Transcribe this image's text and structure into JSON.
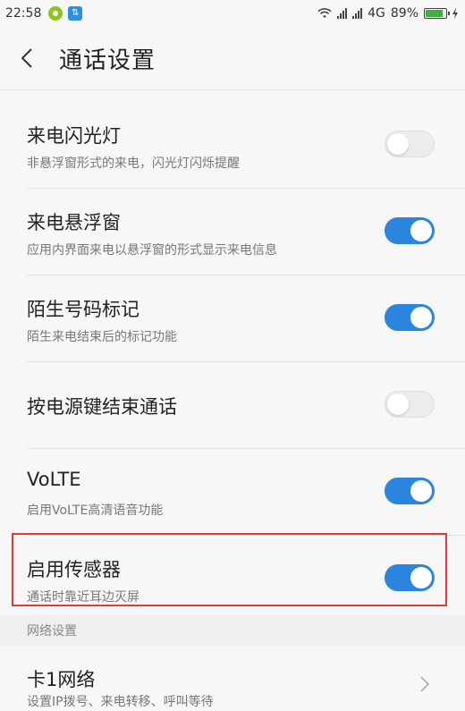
{
  "status_bar": {
    "time": "22:58",
    "network_type": "4G",
    "battery_percent": "89%",
    "battery_level": 0.89
  },
  "header": {
    "title": "通话设置"
  },
  "settings": [
    {
      "title": "来电闪光灯",
      "subtitle": "非悬浮窗形式的来电，闪光灯闪烁提醒",
      "enabled": false
    },
    {
      "title": "来电悬浮窗",
      "subtitle": "应用内界面来电以悬浮窗的形式显示来电信息",
      "enabled": true
    },
    {
      "title": "陌生号码标记",
      "subtitle": "陌生来电结束后的标记功能",
      "enabled": true
    },
    {
      "title": "按电源键结束通话",
      "subtitle": "",
      "enabled": false
    },
    {
      "title": "VoLTE",
      "subtitle": "启用VoLTE高清语音功能",
      "enabled": true
    },
    {
      "title": "启用传感器",
      "subtitle": "通话时靠近耳边灭屏",
      "enabled": true
    }
  ],
  "network_section": {
    "header": "网络设置",
    "item": {
      "title": "卡1网络",
      "subtitle": "设置IP拨号、来电转移、呼叫等待"
    }
  },
  "colors": {
    "accent": "#2b84dd",
    "highlight": "#e23a3a"
  }
}
